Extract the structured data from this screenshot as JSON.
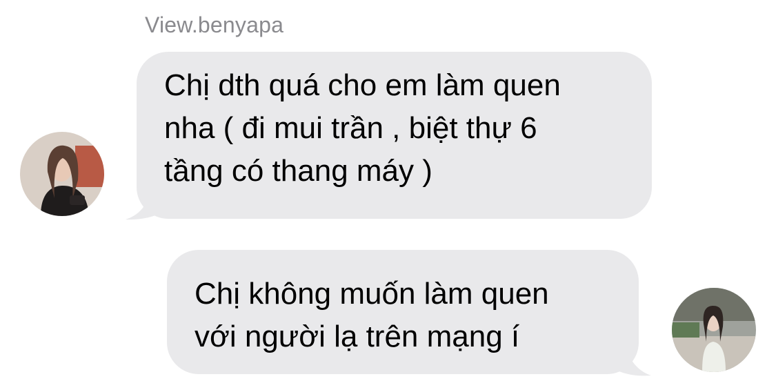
{
  "conversation": {
    "sender_name": "View.benyapa",
    "messages": [
      {
        "direction": "incoming",
        "text": "Chị dth quá cho em làm quen\nnha ( đi mui trần , biệt thự 6\ntầng có thang máy )"
      },
      {
        "direction": "outgoing",
        "text": "Chị không muốn làm quen\nvới người lạ trên mạng í"
      }
    ]
  },
  "colors": {
    "bubble": "#e9e9eb",
    "sender_name": "#8a8a8e",
    "text": "#000000"
  },
  "icons": {
    "incoming_avatar": "profile-photo",
    "outgoing_avatar": "profile-photo"
  }
}
